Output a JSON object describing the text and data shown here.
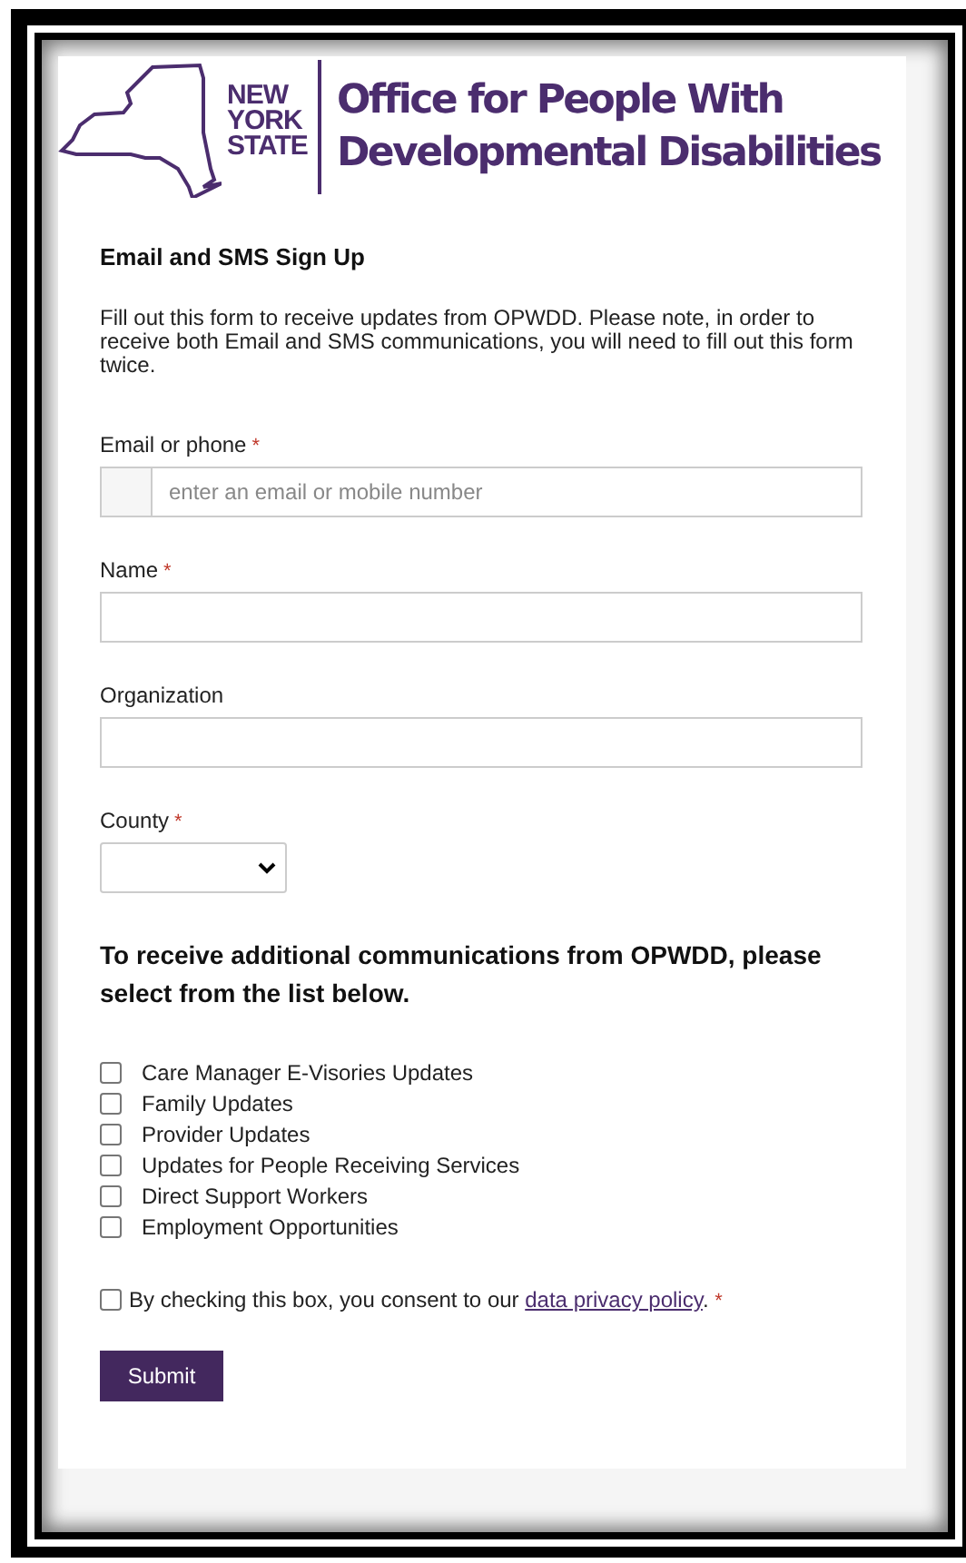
{
  "logo": {
    "state_lines": [
      "NEW",
      "YORK",
      "STATE"
    ],
    "agency_lines": [
      "Office for People With",
      "Developmental Disabilities"
    ]
  },
  "form": {
    "title": "Email and SMS Sign Up",
    "intro": "Fill out this form to receive updates from OPWDD. Please note, in order to receive both Email and SMS communications, you will need to fill out this form twice.",
    "fields": [
      {
        "kind": "prefixed",
        "label": "Email or phone",
        "mark": "*",
        "placeholder": "enter an email or mobile number"
      },
      {
        "kind": "text",
        "label": "Name",
        "mark": "*"
      },
      {
        "kind": "text",
        "label": "Organization"
      },
      {
        "kind": "select",
        "label": "County",
        "mark": "*"
      }
    ],
    "topics_heading": "To receive additional communications from OPWDD, please select from the list below.",
    "topics": [
      {
        "label": "Care Manager E-Visories Updates",
        "checked": false
      },
      {
        "label": "Family Updates",
        "checked": false
      },
      {
        "label": "Provider Updates",
        "checked": false
      },
      {
        "label": "Updates for People Receiving Services",
        "checked": false
      },
      {
        "label": "Direct Support Workers",
        "checked": false
      },
      {
        "label": "Employment Opportunities",
        "checked": false
      }
    ],
    "consent": {
      "checked": false,
      "before": "By checking this box, you consent to our ",
      "link": "data privacy policy",
      "after": ".",
      "mark": "*"
    },
    "submit": "Submit"
  }
}
